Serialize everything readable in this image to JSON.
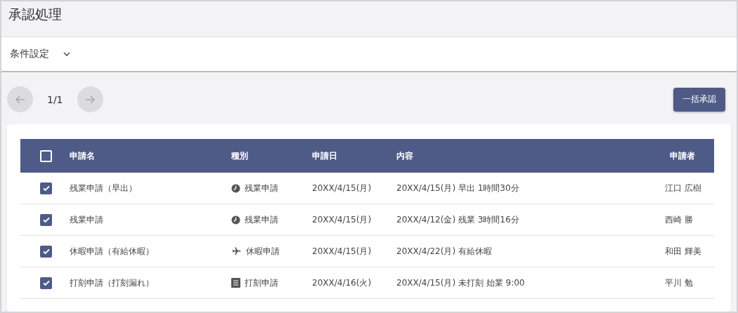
{
  "header": {
    "title": "承認処理"
  },
  "conditions": {
    "label": "条件設定",
    "expanded": false
  },
  "pager": {
    "prev_disabled": true,
    "page": "1/1",
    "next_disabled": true
  },
  "bulk_button": "一括承認",
  "table": {
    "all_checked": false,
    "columns": [
      "申請名",
      "種別",
      "申請日",
      "内容",
      "申請者"
    ],
    "rows": [
      {
        "checked": true,
        "name": "残業申請（早出）",
        "type": {
          "kind": "overtime",
          "label": "残業申請"
        },
        "date": "20XX/4/15(月)",
        "content": "20XX/4/15(月) 早出 1時間30分",
        "applicant": "江口 広樹"
      },
      {
        "checked": true,
        "name": "残業申請",
        "type": {
          "kind": "overtime",
          "label": "残業申請"
        },
        "date": "20XX/4/15(月)",
        "content": "20XX/4/12(金) 残業 3時間16分",
        "applicant": "西崎 勝"
      },
      {
        "checked": true,
        "name": "休暇申請（有給休暇）",
        "type": {
          "kind": "leave",
          "label": "休暇申請"
        },
        "date": "20XX/4/15(月)",
        "content": "20XX/4/22(月) 有給休暇",
        "applicant": "和田 輝美"
      },
      {
        "checked": true,
        "name": "打刻申請（打刻漏れ）",
        "type": {
          "kind": "stamp",
          "label": "打刻申請"
        },
        "date": "20XX/4/16(火)",
        "content": "20XX/4/15(月) 未打刻 始業 9:00",
        "applicant": "平川 勉"
      }
    ]
  }
}
